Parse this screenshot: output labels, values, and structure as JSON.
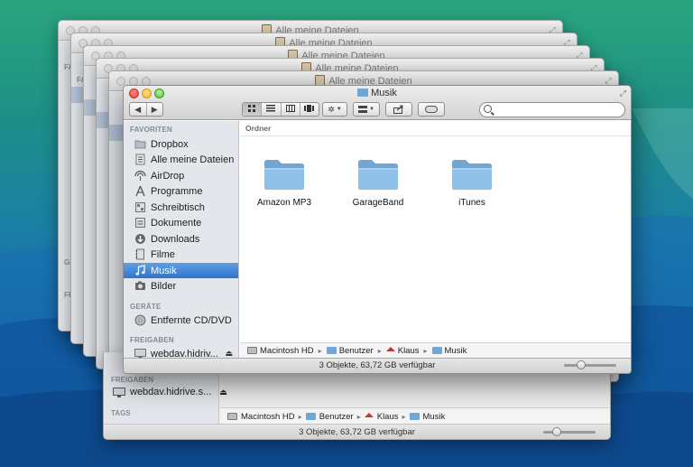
{
  "stack_windows": {
    "title": "Alle meine Dateien",
    "section_label": "FA",
    "section_label_2": "GE",
    "section_label_3": "FR"
  },
  "back_window": {
    "sidebar": {
      "shares_header": "FREIGABEN",
      "share_item": "webdav.hidrive.s...",
      "tags_header": "TAGS"
    },
    "path": [
      "Macintosh HD",
      "Benutzer",
      "Klaus",
      "Musik"
    ],
    "status": "3 Objekte, 63,72 GB verfügbar"
  },
  "window": {
    "title": "Musik",
    "search": {
      "placeholder": ""
    },
    "toolbar": {
      "back_icon": "chevron-left-icon",
      "forward_icon": "chevron-right-icon",
      "view_modes": [
        "icon-view",
        "list-view",
        "column-view",
        "coverflow-view"
      ],
      "action_icon": "gear-icon",
      "arrange_icon": "arrange-icon",
      "share_icon": "share-icon",
      "tags_icon": "tags-icon"
    },
    "sidebar": {
      "favorites_header": "FAVORITEN",
      "favorites": [
        {
          "label": "Dropbox",
          "icon": "folder-icon"
        },
        {
          "label": "Alle meine Dateien",
          "icon": "all-files-icon"
        },
        {
          "label": "AirDrop",
          "icon": "airdrop-icon"
        },
        {
          "label": "Programme",
          "icon": "applications-icon"
        },
        {
          "label": "Schreibtisch",
          "icon": "desktop-icon"
        },
        {
          "label": "Dokumente",
          "icon": "documents-icon"
        },
        {
          "label": "Downloads",
          "icon": "downloads-icon"
        },
        {
          "label": "Filme",
          "icon": "movies-icon"
        },
        {
          "label": "Musik",
          "icon": "music-icon"
        },
        {
          "label": "Bilder",
          "icon": "pictures-icon"
        }
      ],
      "selected": "Musik",
      "devices_header": "GERÄTE",
      "devices": [
        {
          "label": "Entfernte CD/DVD",
          "icon": "disc-icon"
        }
      ],
      "shares_header": "FREIGABEN",
      "shares": [
        {
          "label": "webdav.hidriv...",
          "icon": "display-icon"
        }
      ]
    },
    "content": {
      "group_header": "Ordner",
      "items": [
        {
          "name": "Amazon MP3"
        },
        {
          "name": "GarageBand"
        },
        {
          "name": "iTunes"
        }
      ]
    },
    "path": [
      "Macintosh HD",
      "Benutzer",
      "Klaus",
      "Musik"
    ],
    "status": "3 Objekte, 63,72 GB verfügbar",
    "zoom_level": 0.3
  },
  "colors": {
    "selection": "#2f73cf",
    "folder": "#7ab2e0",
    "desktop_top": "#2aa57c",
    "desktop_bottom": "#0d4d8e"
  }
}
